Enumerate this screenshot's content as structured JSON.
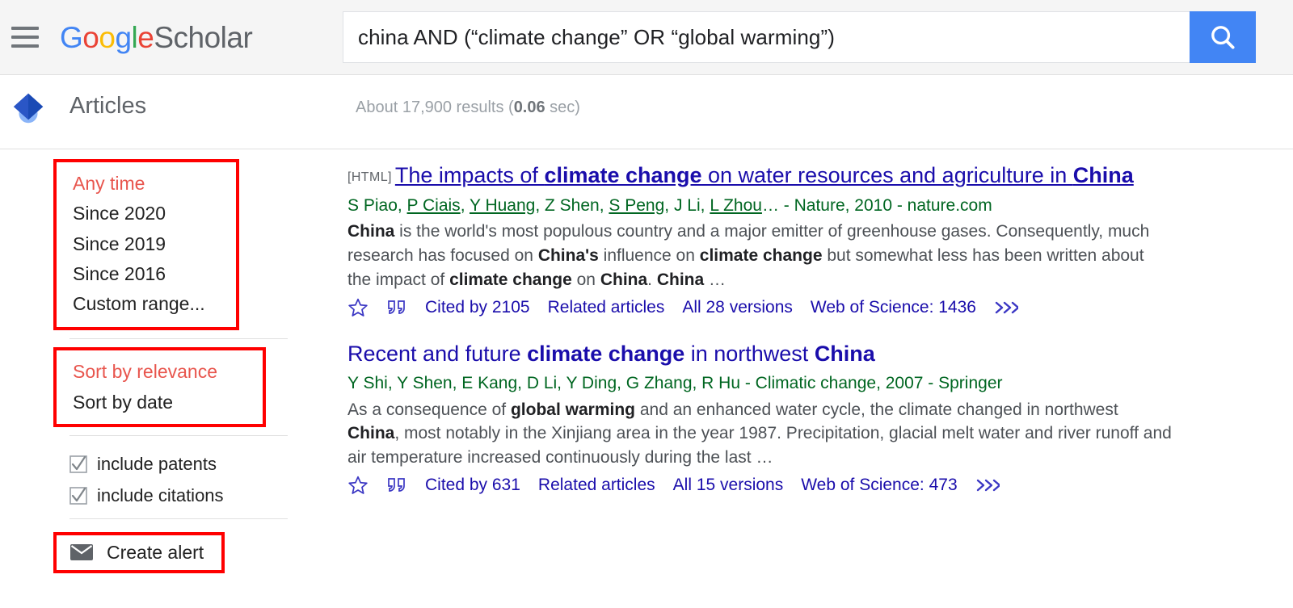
{
  "header": {
    "menu_icon": "hamburger-menu-icon",
    "logo": {
      "google": "Google",
      "scholar": "Scholar",
      "letters": [
        "G",
        "o",
        "o",
        "g",
        "l",
        "e"
      ]
    },
    "search": {
      "value": "china AND (“climate change” OR “global warming”)",
      "placeholder": "Search",
      "button_icon": "search-icon",
      "button_color": "#4285f4"
    }
  },
  "subbar": {
    "icon": "scholar-cap-icon",
    "label": "Articles",
    "stats_prefix": "About 17,900 results (",
    "stats_time": "0.06",
    "stats_suffix": " sec)"
  },
  "sidebar": {
    "time_filters": [
      {
        "label": "Any time",
        "active": true
      },
      {
        "label": "Since 2020",
        "active": false
      },
      {
        "label": "Since 2019",
        "active": false
      },
      {
        "label": "Since 2016",
        "active": false
      },
      {
        "label": "Custom range...",
        "active": false
      }
    ],
    "sort_filters": [
      {
        "label": "Sort by relevance",
        "active": true
      },
      {
        "label": "Sort by date",
        "active": false
      }
    ],
    "checkboxes": [
      {
        "label": "include patents",
        "checked": true,
        "icon": "checkbox-checked-icon"
      },
      {
        "label": "include citations",
        "checked": true,
        "icon": "checkbox-checked-icon"
      }
    ],
    "create_alert": {
      "label": "Create alert",
      "icon": "envelope-icon"
    },
    "annotation_color": "#ff0000"
  },
  "results": [
    {
      "tag": "[HTML]",
      "title_parts": [
        {
          "text": "The impacts of ",
          "bold": false
        },
        {
          "text": "climate change",
          "bold": true
        },
        {
          "text": " on water resources and agriculture in ",
          "bold": false
        },
        {
          "text": "China",
          "bold": true
        }
      ],
      "title_visited": true,
      "authors": [
        {
          "text": "S Piao",
          "link": false
        },
        {
          "text": ", ",
          "link": false
        },
        {
          "text": "P Ciais",
          "link": true
        },
        {
          "text": ", ",
          "link": false
        },
        {
          "text": "Y Huang",
          "link": true
        },
        {
          "text": ", ",
          "link": false
        },
        {
          "text": "Z Shen",
          "link": false
        },
        {
          "text": ", ",
          "link": false
        },
        {
          "text": "S Peng",
          "link": true
        },
        {
          "text": ", ",
          "link": false
        },
        {
          "text": "J Li",
          "link": false
        },
        {
          "text": ", ",
          "link": false
        },
        {
          "text": "L Zhou",
          "link": true
        },
        {
          "text": "… - Nature, 2010 - nature.com",
          "link": false
        }
      ],
      "snippet_parts": [
        {
          "text": "China",
          "bold": true
        },
        {
          "text": " is the world's most populous country and a major emitter of greenhouse gases. Consequently, much research has focused on ",
          "bold": false
        },
        {
          "text": "China's",
          "bold": true
        },
        {
          "text": " influence on ",
          "bold": false
        },
        {
          "text": "climate change",
          "bold": true
        },
        {
          "text": " but somewhat less has been written about the impact of ",
          "bold": false
        },
        {
          "text": "climate change",
          "bold": true
        },
        {
          "text": " on ",
          "bold": false
        },
        {
          "text": "China",
          "bold": true
        },
        {
          "text": ". ",
          "bold": false
        },
        {
          "text": "China",
          "bold": true
        },
        {
          "text": " …",
          "bold": false
        }
      ],
      "actions": {
        "star_icon": "star-outline-icon",
        "quote_icon": "quote-icon",
        "cited_by": "Cited by 2105",
        "related": "Related articles",
        "versions": "All 28 versions",
        "web_of_science": "Web of Science: 1436",
        "more_icon": "double-chevron-icon"
      }
    },
    {
      "tag": "",
      "title_parts": [
        {
          "text": "Recent and future ",
          "bold": false
        },
        {
          "text": "climate change",
          "bold": true
        },
        {
          "text": " in northwest ",
          "bold": false
        },
        {
          "text": "China",
          "bold": true
        }
      ],
      "title_visited": false,
      "authors": [
        {
          "text": "Y Shi, Y Shen, E Kang, D Li, Y Ding, G Zhang, R Hu - Climatic change, 2007 - Springer",
          "link": false
        }
      ],
      "snippet_parts": [
        {
          "text": "As a consequence of ",
          "bold": false
        },
        {
          "text": "global warming",
          "bold": true
        },
        {
          "text": " and an enhanced water cycle, the climate changed in northwest ",
          "bold": false
        },
        {
          "text": "China",
          "bold": true
        },
        {
          "text": ", most notably in the Xinjiang area in the year 1987. Precipitation, glacial melt water and river runoff and air temperature increased continuously during the last …",
          "bold": false
        }
      ],
      "actions": {
        "star_icon": "star-outline-icon",
        "quote_icon": "quote-icon",
        "cited_by": "Cited by 631",
        "related": "Related articles",
        "versions": "All 15 versions",
        "web_of_science": "Web of Science: 473",
        "more_icon": "double-chevron-icon"
      }
    }
  ]
}
